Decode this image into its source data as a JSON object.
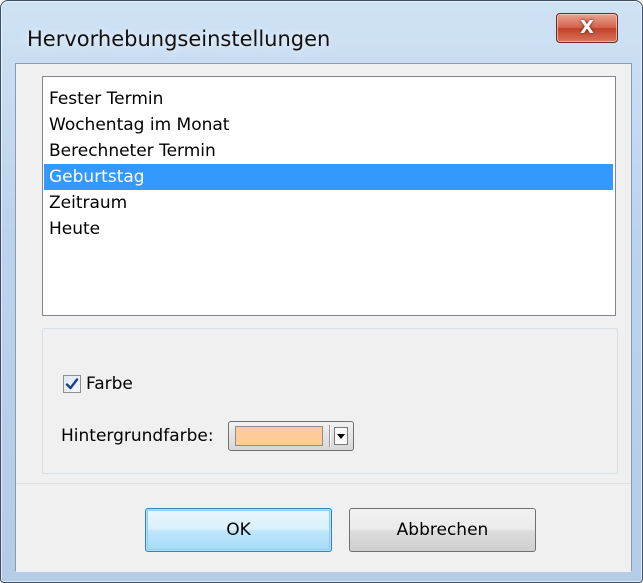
{
  "window": {
    "title": "Hervorhebungseinstellungen",
    "close_glyph": "X"
  },
  "list": {
    "items": [
      {
        "label": "Fester Termin",
        "selected": false
      },
      {
        "label": "Wochentag im Monat",
        "selected": false
      },
      {
        "label": "Berechneter Termin",
        "selected": false
      },
      {
        "label": "Geburtstag",
        "selected": true
      },
      {
        "label": "Zeitraum",
        "selected": false
      },
      {
        "label": "Heute",
        "selected": false
      }
    ]
  },
  "options": {
    "color_checkbox_label": "Farbe",
    "color_checkbox_checked": true,
    "background_color_label": "Hintergrundfarbe:",
    "background_color_value": "#ffcc99"
  },
  "buttons": {
    "ok_label": "OK",
    "cancel_label": "Abbrechen"
  },
  "colors": {
    "selection": "#3399ff",
    "close_button": "#c2412a"
  },
  "icons": {
    "checkmark": "check-icon",
    "dropdown": "dropdown-arrow-icon"
  }
}
